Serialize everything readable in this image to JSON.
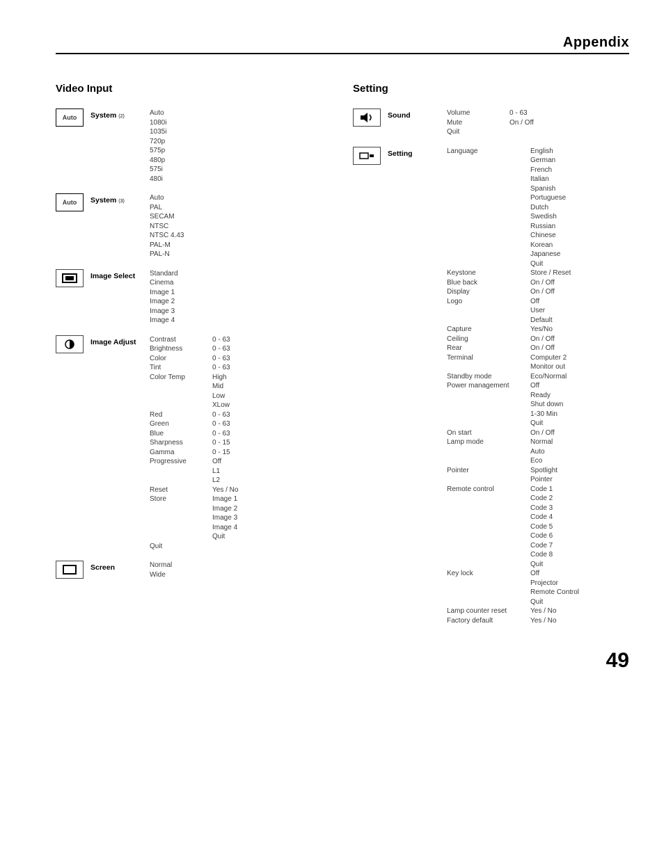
{
  "header": {
    "title": "Appendix"
  },
  "page_number": "49",
  "video_input": {
    "title": "Video Input",
    "system2": {
      "label": "System",
      "note": "(2)",
      "icon_text": "Auto",
      "items": [
        "Auto",
        "1080i",
        "1035i",
        "720p",
        "575p",
        "480p",
        "575i",
        "480i"
      ]
    },
    "system3": {
      "label": "System",
      "note": "(3)",
      "icon_text": "Auto",
      "items": [
        "Auto",
        "PAL",
        "SECAM",
        "NTSC",
        "NTSC 4.43",
        "PAL-M",
        "PAL-N"
      ]
    },
    "image_select": {
      "label": "Image Select",
      "items": [
        "Standard",
        "Cinema",
        "Image 1",
        "Image 2",
        "Image 3",
        "Image 4"
      ]
    },
    "image_adjust": {
      "label": "Image Adjust",
      "rows": [
        {
          "name": "Contrast",
          "vals": [
            "0 - 63"
          ]
        },
        {
          "name": "Brightness",
          "vals": [
            "0 - 63"
          ]
        },
        {
          "name": "Color",
          "vals": [
            "0 - 63"
          ]
        },
        {
          "name": "Tint",
          "vals": [
            "0 - 63"
          ]
        },
        {
          "name": "Color Temp",
          "vals": [
            "High",
            "Mid",
            "Low",
            "XLow"
          ]
        },
        {
          "name": "Red",
          "vals": [
            "0 - 63"
          ]
        },
        {
          "name": "Green",
          "vals": [
            "0 - 63"
          ]
        },
        {
          "name": "Blue",
          "vals": [
            "0 - 63"
          ]
        },
        {
          "name": "Sharpness",
          "vals": [
            "0 - 15"
          ]
        },
        {
          "name": "Gamma",
          "vals": [
            "0 - 15"
          ]
        },
        {
          "name": "Progressive",
          "vals": [
            "Off",
            "L1",
            "L2"
          ]
        },
        {
          "name": "Reset",
          "vals": [
            "Yes / No"
          ]
        },
        {
          "name": "Store",
          "vals": [
            "Image 1",
            "Image 2",
            "Image 3",
            "Image 4",
            "Quit"
          ]
        },
        {
          "name": "Quit",
          "vals": []
        }
      ]
    },
    "screen": {
      "label": "Screen",
      "items": [
        "Normal",
        "Wide"
      ]
    }
  },
  "setting": {
    "title": "Setting",
    "sound": {
      "label": "Sound",
      "rows": [
        {
          "name": "Volume",
          "vals": [
            "0 - 63"
          ]
        },
        {
          "name": "Mute",
          "vals": [
            "On / Off"
          ]
        },
        {
          "name": "Quit",
          "vals": []
        }
      ]
    },
    "settings": {
      "label": "Setting",
      "rows": [
        {
          "name": "Language",
          "vals": [
            "English",
            "German",
            "French",
            "Italian",
            "Spanish",
            "Portuguese",
            "Dutch",
            "Swedish",
            "Russian",
            "Chinese",
            "Korean",
            "Japanese",
            "Quit"
          ]
        },
        {
          "name": "Keystone",
          "vals": [
            "Store / Reset"
          ]
        },
        {
          "name": "Blue back",
          "vals": [
            "On / Off"
          ]
        },
        {
          "name": "Display",
          "vals": [
            "On / Off"
          ]
        },
        {
          "name": "Logo",
          "vals": [
            "Off",
            "User",
            "Default"
          ]
        },
        {
          "name": "Capture",
          "vals": [
            "Yes/No"
          ]
        },
        {
          "name": "Ceiling",
          "vals": [
            "On / Off"
          ]
        },
        {
          "name": "Rear",
          "vals": [
            "On / Off"
          ]
        },
        {
          "name": "Terminal",
          "vals": [
            "Computer 2",
            "Monitor out"
          ]
        },
        {
          "name": "Standby mode",
          "vals": [
            "Eco/Normal"
          ]
        },
        {
          "name": "Power management",
          "vals": [
            "Off",
            "Ready",
            "Shut down",
            "1-30 Min",
            "Quit"
          ]
        },
        {
          "name": "On start",
          "vals": [
            "On / Off"
          ]
        },
        {
          "name": "Lamp mode",
          "vals": [
            "Normal",
            "Auto",
            "Eco"
          ]
        },
        {
          "name": "Pointer",
          "vals": [
            "Spotlight",
            "Pointer"
          ]
        },
        {
          "name": "Remote control",
          "vals": [
            "Code 1",
            "Code 2",
            "Code 3",
            "Code 4",
            "Code 5",
            "Code 6",
            "Code 7",
            "Code 8",
            "Quit"
          ]
        },
        {
          "name": "Key lock",
          "vals": [
            "Off",
            "Projector",
            "Remote Control",
            "Quit"
          ]
        },
        {
          "name": "Lamp counter reset",
          "vals": [
            "Yes / No"
          ]
        },
        {
          "name": "Factory default",
          "vals": [
            "Yes / No"
          ]
        }
      ]
    }
  }
}
